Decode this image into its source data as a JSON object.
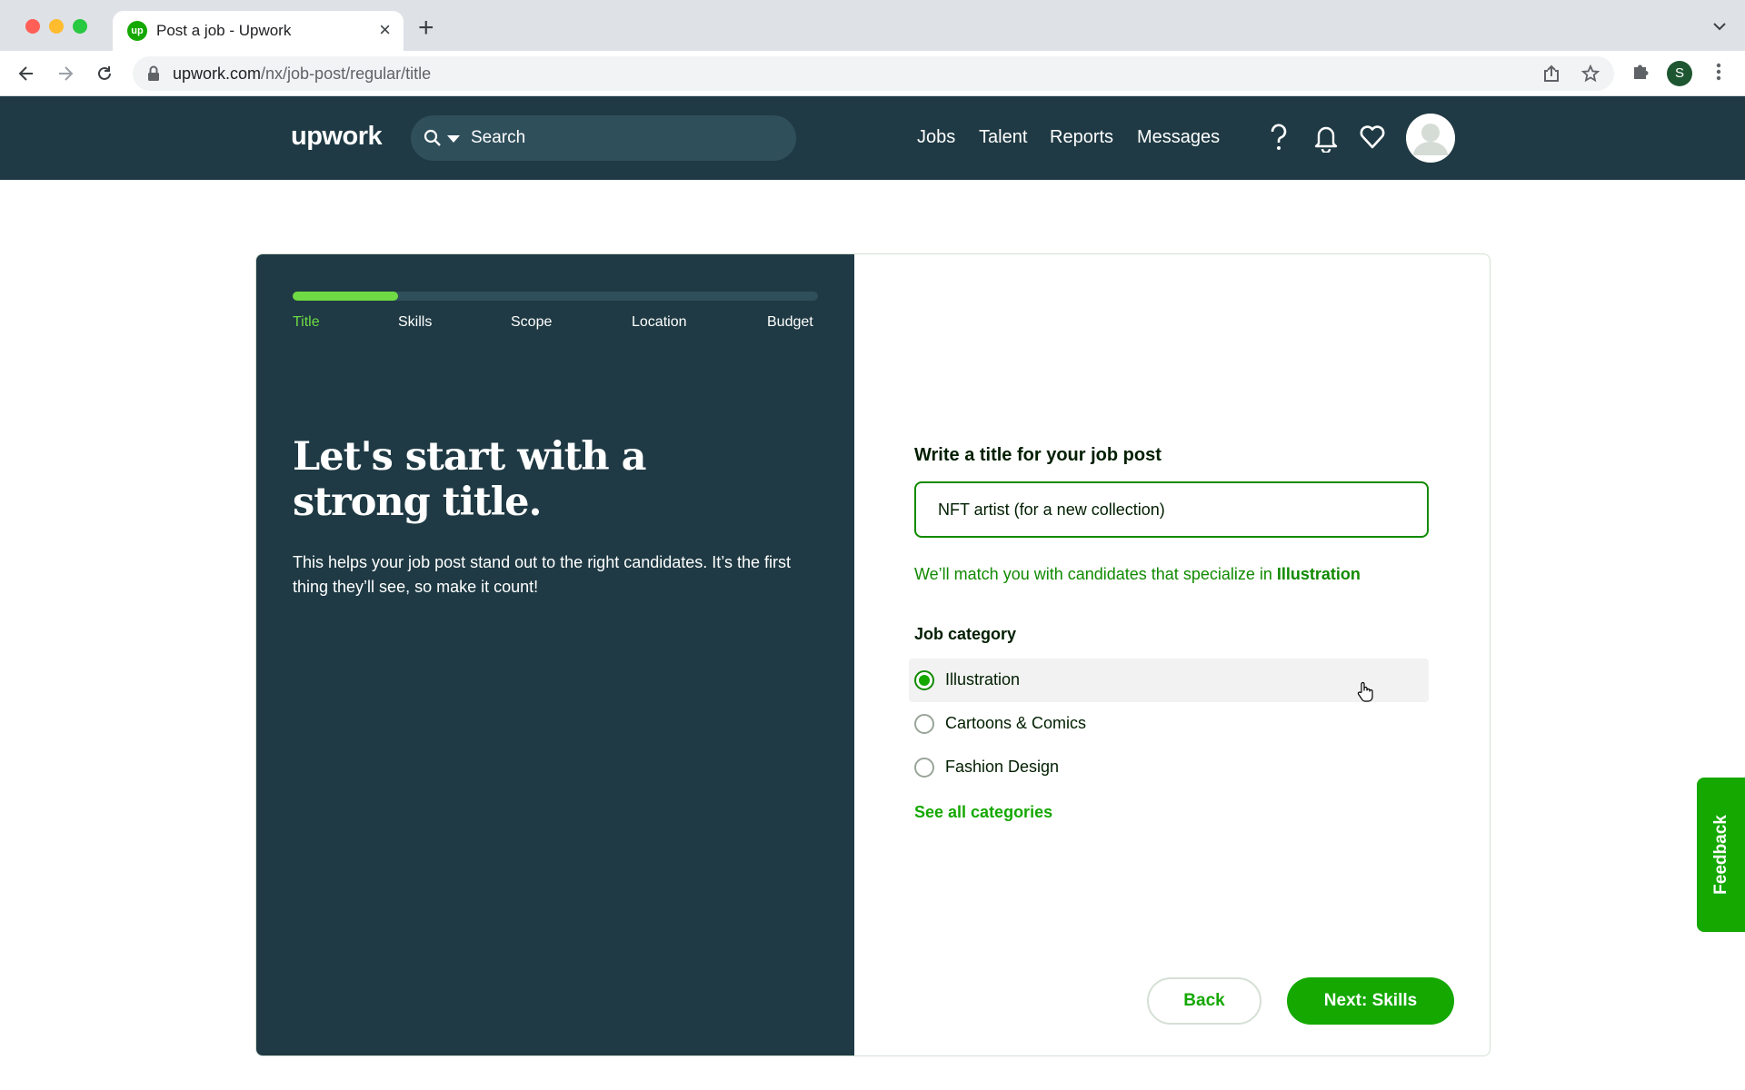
{
  "browser": {
    "tab_title": "Post a job - Upwork",
    "favicon_text": "up",
    "url_host": "upwork.com",
    "url_path": "/nx/job-post/regular/title",
    "profile_initial": "S"
  },
  "header": {
    "logo": "upwork",
    "search_placeholder": "Search",
    "nav": [
      "Jobs",
      "Talent",
      "Reports",
      "Messages"
    ]
  },
  "progress": {
    "fraction": 0.2,
    "steps": [
      "Title",
      "Skills",
      "Scope",
      "Location",
      "Budget"
    ],
    "active_step": "Title"
  },
  "intro": {
    "headline": "Let's start with a strong title.",
    "subtext": "This helps your job post stand out to the right candidates. It’s the first thing they’ll see, so make it count!"
  },
  "form": {
    "title_label": "Write a title for your job post",
    "title_value": "NFT artist (for a new collection)",
    "match_prefix": "We’ll match you with candidates that specialize in ",
    "match_category": "Illustration",
    "category_label": "Job category",
    "categories": [
      {
        "label": "Illustration",
        "selected": true
      },
      {
        "label": "Cartoons & Comics",
        "selected": false
      },
      {
        "label": "Fashion Design",
        "selected": false
      }
    ],
    "see_all": "See all categories",
    "back_label": "Back",
    "next_label": "Next: Skills"
  },
  "feedback_label": "Feedback",
  "colors": {
    "dark_panel": "#1f3a44",
    "brand_green": "#14a800",
    "progress_green": "#6fda44"
  }
}
